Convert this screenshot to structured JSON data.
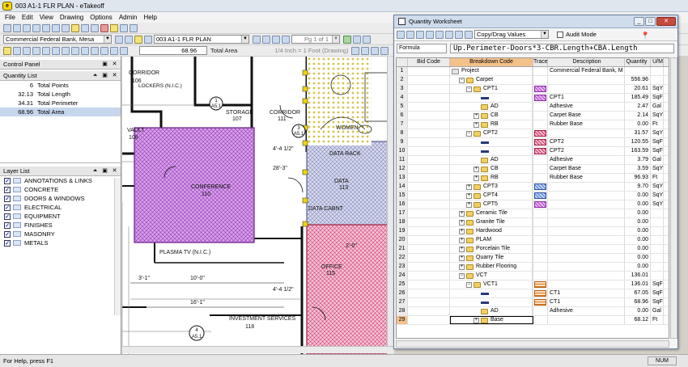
{
  "window": {
    "title": "003 A1-1 FLR PLAN - eTakeoff",
    "app_icon": "e"
  },
  "menu": [
    "File",
    "Edit",
    "View",
    "Drawing",
    "Options",
    "Admin",
    "Help"
  ],
  "toolbar": {
    "project": "Commercial Federal Bank, Mesa",
    "drawing": "003 A1-1 FLR PLAN",
    "page": "Pg 1 of 1",
    "total_value": "68.96",
    "total_label": "Total Area",
    "scale": "1/4 Inch = 1 Foot (Drawing)"
  },
  "control_panel": {
    "title": "Control Panel"
  },
  "quantity_list": {
    "title": "Quantity List",
    "items": [
      {
        "value": "6",
        "label": "Total Points"
      },
      {
        "value": "32.13",
        "label": "Total Length"
      },
      {
        "value": "34.31",
        "label": "Total Perimeter"
      },
      {
        "value": "68.96",
        "label": "Total Area",
        "selected": true
      }
    ]
  },
  "layer_list": {
    "title": "Layer List",
    "items": [
      "ANNOTATIONS & LINKS",
      "CONCRETE",
      "DOORS & WINDOWS",
      "ELECTRICAL",
      "EQUIPMENT",
      "FINISHES",
      "MASONRY",
      "METALS"
    ]
  },
  "drawing": {
    "labels": {
      "corridor1": "CORRIDOR",
      "corridor1_no": "106",
      "lockers": "LOCKERS (N.I.C.)",
      "storage": "STORAGE",
      "storage_no": "107",
      "corridor2": "CORRIDOR",
      "corridor2_no": "111",
      "vault": "VAULT",
      "vault_no": "108",
      "conference": "CONFERENCE",
      "conference_no": "110",
      "womens": "WOMEN",
      "datarack": "DATA RACK",
      "data": "DATA",
      "data_no": "113",
      "datacabnt": "DATA CABNT",
      "plasma": "PLASMA TV (N.I.C.)",
      "office": "OFFICE",
      "office_no": "115",
      "investment": "INVESTMENT SERVICES",
      "investment_no": "118",
      "sheet1": "A5.1",
      "sheet1_no": "1",
      "sheet2": "A5.1",
      "sheet2_no": "3",
      "sheet3": "A5.1",
      "sheet3_no": "4"
    },
    "dims": [
      "4'-4 1/2\"",
      "28'-3\"",
      "3'-1\"",
      "10'-0\"",
      "4'-4 1/2\"",
      "16'-1\"",
      "2'-0\""
    ]
  },
  "status": {
    "help": "For Help, press F1",
    "num": "NUM"
  },
  "worksheet": {
    "title": "Quantity Worksheet",
    "copy_mode": "Copy/Drag Values",
    "audit_label": "Audit Mode",
    "formula_label": "Formula",
    "formula_value": "Up.Perimeter-Doors*3-CBR.Length+CBA.Length",
    "columns": [
      "Bid Code",
      "Breakdown Code",
      "Trace",
      "Description",
      "Quantity",
      "U/M"
    ],
    "rows": [
      {
        "n": "1",
        "indent": 0,
        "tog": "",
        "icon": "proj",
        "bd": "Project",
        "trace": "",
        "desc": "Commercial Federal Bank, M",
        "qty": "",
        "um": ""
      },
      {
        "n": "2",
        "indent": 1,
        "tog": "-",
        "icon": "fld",
        "bd": "Carpet",
        "trace": "",
        "desc": "",
        "qty": "556.96",
        "um": ""
      },
      {
        "n": "3",
        "indent": 2,
        "tog": "-",
        "icon": "fld",
        "bd": "CPT1",
        "trace": "purple",
        "desc": "",
        "qty": "20.61",
        "um": "SqYd"
      },
      {
        "n": "4",
        "indent": 3,
        "tog": "",
        "icon": "dash",
        "bd": "",
        "trace": "purple",
        "desc": "CPT1",
        "qty": "185.49",
        "um": "SqFt"
      },
      {
        "n": "5",
        "indent": 3,
        "tog": "",
        "icon": "fld",
        "bd": "AD",
        "trace": "",
        "desc": "Adhesive",
        "qty": "2.47",
        "um": "Gal"
      },
      {
        "n": "6",
        "indent": 3,
        "tog": "+",
        "icon": "fld",
        "bd": "CB",
        "trace": "",
        "desc": "Carpet Base",
        "qty": "2.14",
        "um": "SqYd"
      },
      {
        "n": "7",
        "indent": 3,
        "tog": "+",
        "icon": "fld",
        "bd": "RB",
        "trace": "",
        "desc": "Rubber Base",
        "qty": "0.00",
        "um": "Ft"
      },
      {
        "n": "8",
        "indent": 2,
        "tog": "-",
        "icon": "fld",
        "bd": "CPT2",
        "trace": "pink",
        "desc": "",
        "qty": "31.57",
        "um": "SqYd"
      },
      {
        "n": "9",
        "indent": 3,
        "tog": "",
        "icon": "dash",
        "bd": "",
        "trace": "pink",
        "desc": "CPT2",
        "qty": "120.55",
        "um": "SqFt"
      },
      {
        "n": "10",
        "indent": 3,
        "tog": "",
        "icon": "dash",
        "bd": "",
        "trace": "pink",
        "desc": "CPT2",
        "qty": "163.59",
        "um": "SqFt"
      },
      {
        "n": "11",
        "indent": 3,
        "tog": "",
        "icon": "fld",
        "bd": "AD",
        "trace": "",
        "desc": "Adhesive",
        "qty": "3.79",
        "um": "Gal"
      },
      {
        "n": "12",
        "indent": 3,
        "tog": "+",
        "icon": "fld",
        "bd": "CB",
        "trace": "",
        "desc": "Carpet Base",
        "qty": "3.59",
        "um": "SqYd"
      },
      {
        "n": "13",
        "indent": 3,
        "tog": "+",
        "icon": "fld",
        "bd": "RB",
        "trace": "",
        "desc": "Rubber Base",
        "qty": "96.93",
        "um": "Ft"
      },
      {
        "n": "14",
        "indent": 2,
        "tog": "+",
        "icon": "fld",
        "bd": "CPT3",
        "trace": "blue",
        "desc": "",
        "qty": "9.70",
        "um": "SqYd"
      },
      {
        "n": "15",
        "indent": 2,
        "tog": "+",
        "icon": "fld",
        "bd": "CPT4",
        "trace": "blue",
        "desc": "",
        "qty": "0.00",
        "um": "SqYd"
      },
      {
        "n": "16",
        "indent": 2,
        "tog": "+",
        "icon": "fld",
        "bd": "CPT5",
        "trace": "purple",
        "desc": "",
        "qty": "0.00",
        "um": "SqYd"
      },
      {
        "n": "17",
        "indent": 1,
        "tog": "+",
        "icon": "fld",
        "bd": "Ceramic Tile",
        "trace": "",
        "desc": "",
        "qty": "0.00",
        "um": ""
      },
      {
        "n": "18",
        "indent": 1,
        "tog": "+",
        "icon": "fld",
        "bd": "Granite Tile",
        "trace": "",
        "desc": "",
        "qty": "0.00",
        "um": ""
      },
      {
        "n": "19",
        "indent": 1,
        "tog": "+",
        "icon": "fld",
        "bd": "Hardwood",
        "trace": "",
        "desc": "",
        "qty": "0.00",
        "um": ""
      },
      {
        "n": "20",
        "indent": 1,
        "tog": "+",
        "icon": "fld",
        "bd": "PLAM",
        "trace": "",
        "desc": "",
        "qty": "0.00",
        "um": ""
      },
      {
        "n": "21",
        "indent": 1,
        "tog": "+",
        "icon": "fld",
        "bd": "Porcelain Tile",
        "trace": "",
        "desc": "",
        "qty": "0.00",
        "um": ""
      },
      {
        "n": "22",
        "indent": 1,
        "tog": "+",
        "icon": "fld",
        "bd": "Quarry Tile",
        "trace": "",
        "desc": "",
        "qty": "0.00",
        "um": ""
      },
      {
        "n": "23",
        "indent": 1,
        "tog": "+",
        "icon": "fld",
        "bd": "Rubber Flooring",
        "trace": "",
        "desc": "",
        "qty": "0.00",
        "um": ""
      },
      {
        "n": "24",
        "indent": 1,
        "tog": "-",
        "icon": "fld",
        "bd": "VCT",
        "trace": "",
        "desc": "",
        "qty": "136.01",
        "um": ""
      },
      {
        "n": "25",
        "indent": 2,
        "tog": "-",
        "icon": "fld",
        "bd": "VCT1",
        "trace": "orange",
        "desc": "",
        "qty": "136.01",
        "um": "SqFt"
      },
      {
        "n": "26",
        "indent": 3,
        "tog": "",
        "icon": "dash",
        "bd": "",
        "trace": "orange",
        "desc": "CT1",
        "qty": "67.05",
        "um": "SqFt"
      },
      {
        "n": "27",
        "indent": 3,
        "tog": "",
        "icon": "dash",
        "bd": "",
        "trace": "orange",
        "desc": "CT1",
        "qty": "68.96",
        "um": "SqFt"
      },
      {
        "n": "28",
        "indent": 3,
        "tog": "",
        "icon": "fld",
        "bd": "AD",
        "trace": "",
        "desc": "Adhesive",
        "qty": "0.00",
        "um": "Gal"
      },
      {
        "n": "29",
        "indent": 3,
        "tog": "+",
        "icon": "fld",
        "bd": "Base",
        "trace": "",
        "desc": "",
        "qty": "68.12",
        "um": "Ft",
        "highlight": true
      }
    ]
  }
}
